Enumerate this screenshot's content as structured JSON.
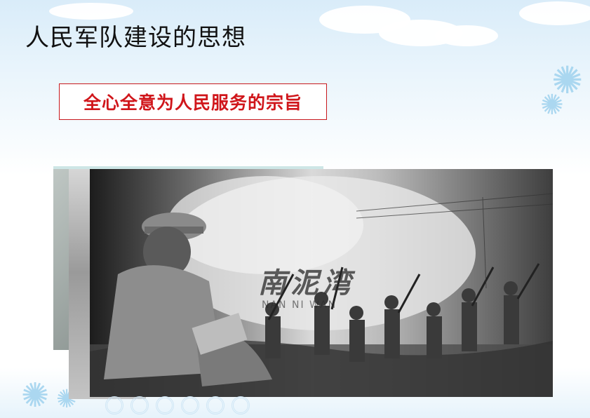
{
  "slide": {
    "title": "人民军队建设的思想",
    "subtitle": "全心全意为人民服务的宗旨"
  },
  "photo": {
    "caption": "南泥湾",
    "caption_sub": "NAN NI WAN"
  },
  "decorations": {
    "flower_glyph": "✺",
    "cloud_color": "#ffffff",
    "sky_color": "#d9ecf9"
  },
  "colors": {
    "accent": "#d0161b",
    "title": "#111111"
  }
}
